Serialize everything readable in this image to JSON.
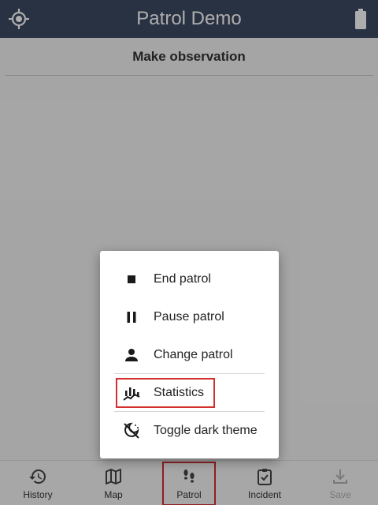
{
  "app_bar": {
    "title": "Patrol Demo",
    "background_color": "#3d4a63",
    "left_icon": "crosshair-location-icon",
    "right_icon": "battery-icon"
  },
  "page": {
    "heading": "Make observation"
  },
  "popup_menu": {
    "items": [
      {
        "label": "End patrol",
        "icon": "stop-icon"
      },
      {
        "label": "Pause patrol",
        "icon": "pause-icon"
      },
      {
        "label": "Change patrol",
        "icon": "person-icon"
      },
      {
        "label": "Statistics",
        "icon": "statistics-icon"
      },
      {
        "label": "Toggle dark theme",
        "icon": "theme-toggle-icon"
      }
    ]
  },
  "bottom_nav": {
    "items": [
      {
        "label": "History",
        "icon": "history-icon",
        "enabled": true
      },
      {
        "label": "Map",
        "icon": "map-icon",
        "enabled": true
      },
      {
        "label": "Patrol",
        "icon": "footprints-icon",
        "enabled": true,
        "selected": true
      },
      {
        "label": "Incident",
        "icon": "clipboard-check-icon",
        "enabled": true
      },
      {
        "label": "Save",
        "icon": "download-icon",
        "enabled": false
      }
    ]
  },
  "colors": {
    "highlight_outline": "#d32f2f",
    "scrim": "rgba(0,0,0,0.32)",
    "disabled_text": "#b3b3b3"
  }
}
